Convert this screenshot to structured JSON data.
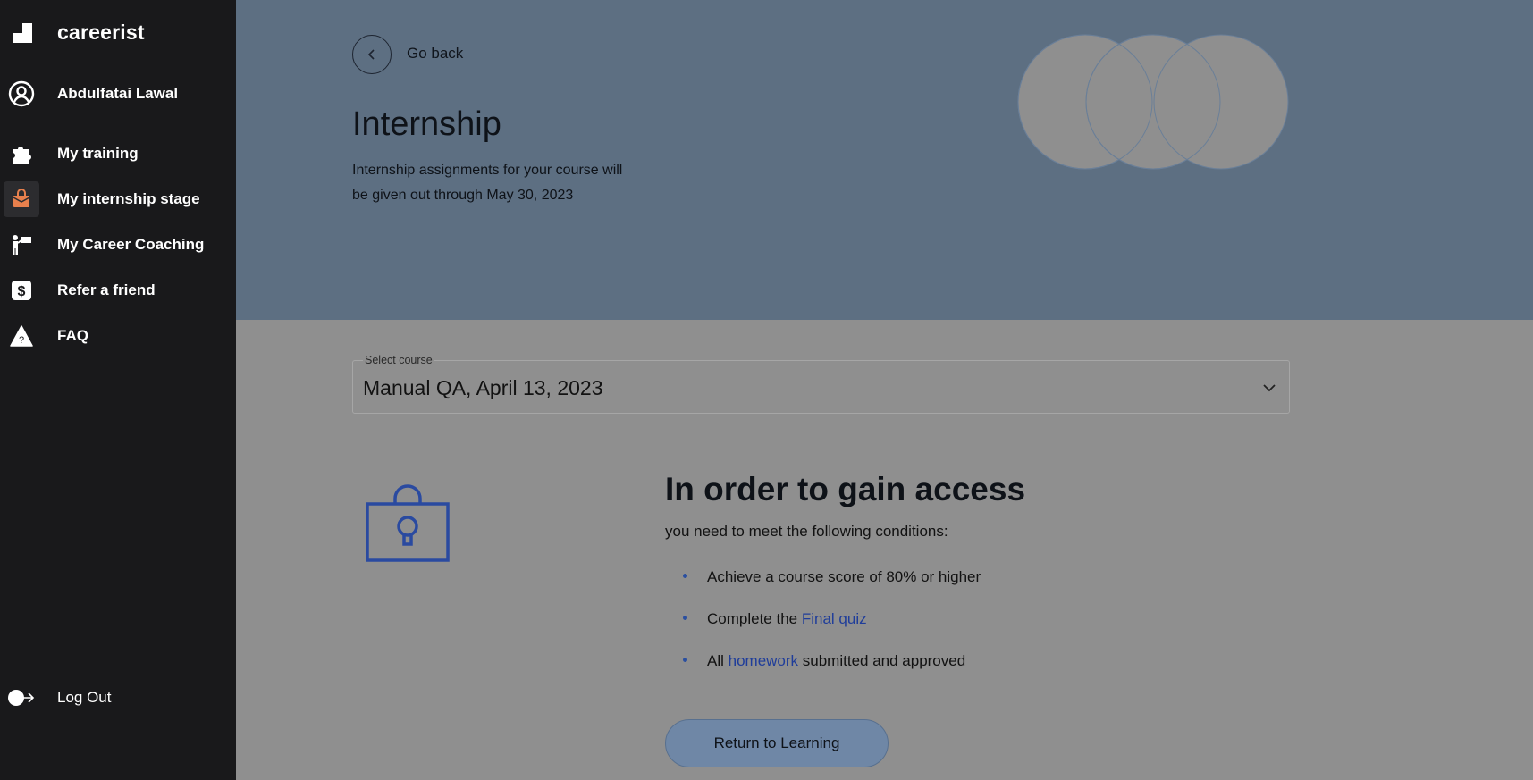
{
  "brand": {
    "name": "careerist"
  },
  "user": {
    "name": "Abdulfatai Lawal"
  },
  "sidebar": {
    "items": [
      {
        "label": "My training",
        "icon": "puzzle-icon"
      },
      {
        "label": "My internship stage",
        "icon": "briefcase-icon",
        "active": true
      },
      {
        "label": "My Career Coaching",
        "icon": "coaching-icon"
      },
      {
        "label": "Refer a friend",
        "icon": "dollar-icon"
      },
      {
        "label": "FAQ",
        "icon": "warning-question-icon"
      }
    ],
    "logout_label": "Log Out"
  },
  "header": {
    "back_label": "Go back",
    "title": "Internship",
    "description": "Internship assignments for your course will be given out through May 30, 2023"
  },
  "course_select": {
    "label": "Select course",
    "value": "Manual QA, April 13, 2023"
  },
  "access": {
    "title": "In order to gain access",
    "subtitle": "you need to meet the following conditions:",
    "conditions": {
      "c1": {
        "text": "Achieve a course score of 80% or higher"
      },
      "c2": {
        "before": "Complete the ",
        "link": "Final quiz",
        "after": ""
      },
      "c3": {
        "before": "All ",
        "link": "homework",
        "after": " submitted and approved"
      }
    },
    "button_label": "Return to Learning"
  },
  "colors": {
    "sidebar_bg": "#19191b",
    "hero_bg": "#5d6f82",
    "accent_orange": "#e8804d",
    "link_blue": "#1f3d9a",
    "button_bg": "#6f87a6"
  }
}
